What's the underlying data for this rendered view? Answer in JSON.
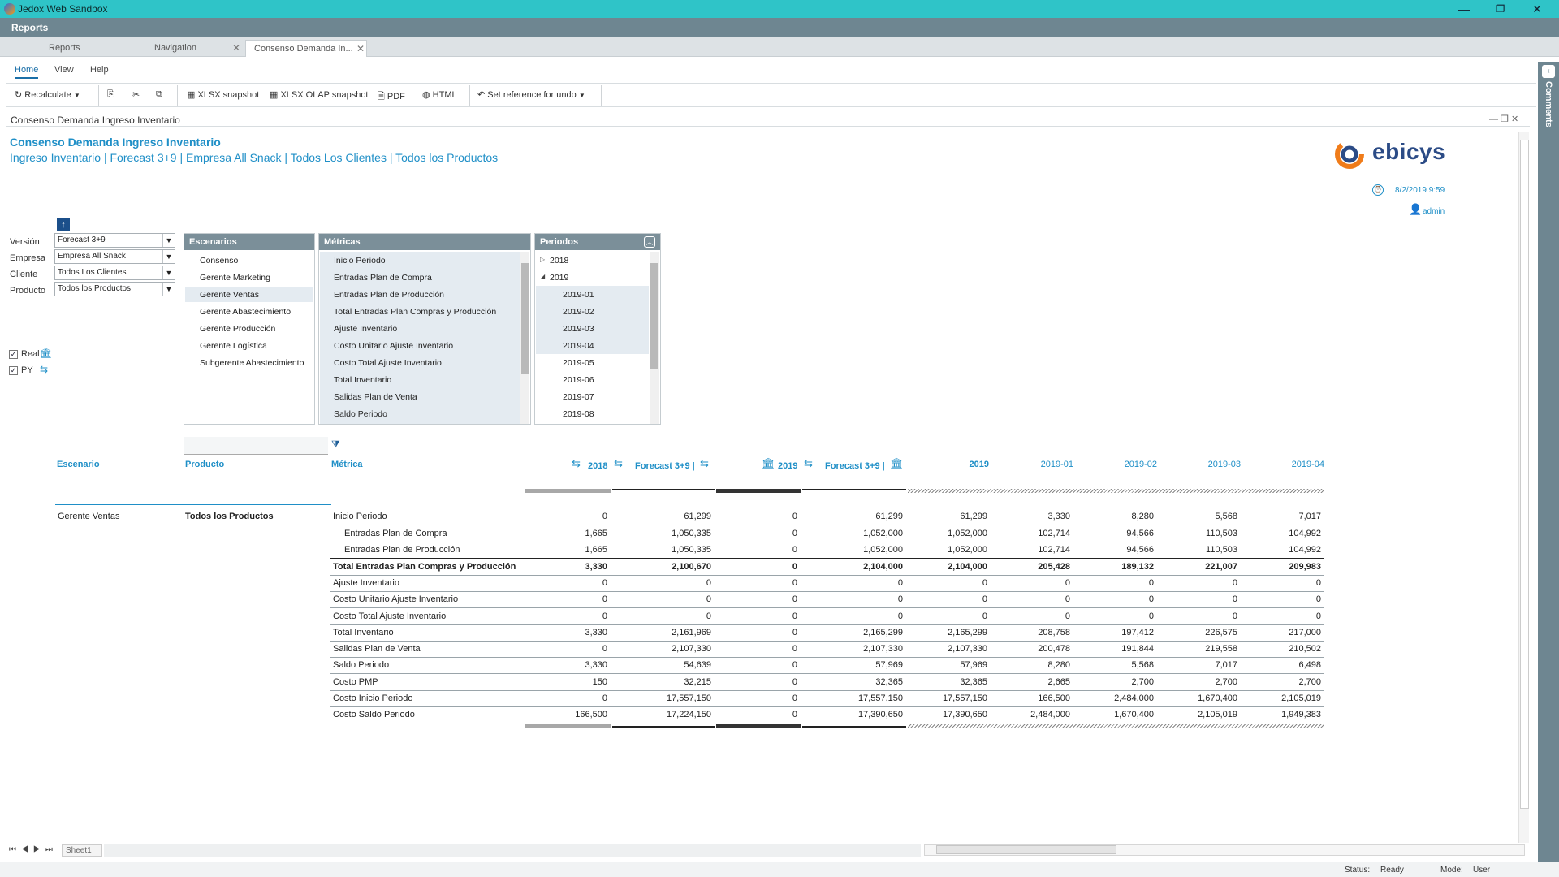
{
  "window": {
    "title": "Jedox Web Sandbox",
    "minimize": "—",
    "maximize": "❐",
    "close": "✕"
  },
  "app": {
    "reports_label": "Reports"
  },
  "tabs": [
    {
      "label": "Reports"
    },
    {
      "label": "Navigation",
      "close": "✕"
    },
    {
      "label": "Consenso Demanda In...",
      "close": "✕"
    }
  ],
  "ribbon": {
    "tabs": [
      "Home",
      "View",
      "Help"
    ],
    "toolbar": {
      "recalculate": "Recalculate",
      "xlsx": "XLSX snapshot",
      "xlsx_olap": "XLSX OLAP snapshot",
      "pdf": "PDF",
      "html": "HTML",
      "set_ref": "Set reference for undo"
    }
  },
  "sheet": {
    "title": "Consenso Demanda Ingreso Inventario",
    "heading": "Consenso Demanda Ingreso Inventario",
    "subheading": "Ingreso Inventario  | Forecast 3+9 | Empresa All Snack | Todos Los Clientes | Todos los Productos",
    "logo": "ebicys",
    "timestamp": "8/2/2019 9:59",
    "user": "admin"
  },
  "side": {
    "comments": "Comments"
  },
  "filters": [
    {
      "label": "Versión",
      "value": "Forecast 3+9"
    },
    {
      "label": "Empresa",
      "value": "Empresa All Snack"
    },
    {
      "label": "Cliente",
      "value": "Todos Los Clientes"
    },
    {
      "label": "Producto",
      "value": "Todos los Productos"
    }
  ],
  "checks": [
    {
      "label": "Real",
      "checked": true
    },
    {
      "label": "PY",
      "checked": true
    }
  ],
  "lists": {
    "escenarios": {
      "title": "Escenarios",
      "items": [
        "Consenso",
        "Gerente Marketing",
        "Gerente Ventas",
        "Gerente Abastecimiento",
        "Gerente Producción",
        "Gerente Logística",
        "Subgerente Abastecimiento"
      ],
      "selected": 2
    },
    "metricas": {
      "title": "Métricas",
      "items": [
        "Inicio Periodo",
        "Entradas Plan de Compra",
        "Entradas Plan de Producción",
        "Total Entradas Plan Compras y Producción",
        "Ajuste Inventario",
        "Costo Unitario Ajuste Inventario",
        "Costo Total Ajuste Inventario",
        "Total Inventario",
        "Salidas Plan de Venta",
        "Saldo Periodo"
      ]
    },
    "periodos": {
      "title": "Periodos",
      "items": [
        "2018",
        "2019",
        "2019-01",
        "2019-02",
        "2019-03",
        "2019-04",
        "2019-05",
        "2019-06",
        "2019-07",
        "2019-08"
      ]
    }
  },
  "grid": {
    "headers": {
      "escenario": "Escenario",
      "producto": "Producto",
      "metrica": "Métrica",
      "cols": [
        "2018",
        "Forecast 3+9 |",
        "2019",
        "Forecast 3+9 |",
        "2019",
        "2019-01",
        "2019-02",
        "2019-03",
        "2019-04"
      ]
    },
    "row_scenario": "Gerente Ventas",
    "row_product": "Todos los Productos",
    "rows": [
      {
        "m": "Inicio Periodo",
        "v": [
          "0",
          "61,299",
          "0",
          "61,299",
          "61,299",
          "3,330",
          "8,280",
          "5,568",
          "7,017"
        ]
      },
      {
        "m": "Entradas Plan de Compra",
        "v": [
          "1,665",
          "1,050,335",
          "0",
          "1,052,000",
          "1,052,000",
          "102,714",
          "94,566",
          "110,503",
          "104,992"
        ]
      },
      {
        "m": "Entradas Plan de Producción",
        "v": [
          "1,665",
          "1,050,335",
          "0",
          "1,052,000",
          "1,052,000",
          "102,714",
          "94,566",
          "110,503",
          "104,992"
        ]
      },
      {
        "m": "Total Entradas Plan Compras y Producción",
        "v": [
          "3,330",
          "2,100,670",
          "0",
          "2,104,000",
          "2,104,000",
          "205,428",
          "189,132",
          "221,007",
          "209,983"
        ]
      },
      {
        "m": "Ajuste Inventario",
        "v": [
          "0",
          "0",
          "0",
          "0",
          "0",
          "0",
          "0",
          "0",
          "0"
        ]
      },
      {
        "m": "Costo Unitario Ajuste Inventario",
        "v": [
          "0",
          "0",
          "0",
          "0",
          "0",
          "0",
          "0",
          "0",
          "0"
        ]
      },
      {
        "m": "Costo Total Ajuste Inventario",
        "v": [
          "0",
          "0",
          "0",
          "0",
          "0",
          "0",
          "0",
          "0",
          "0"
        ]
      },
      {
        "m": "Total Inventario",
        "v": [
          "3,330",
          "2,161,969",
          "0",
          "2,165,299",
          "2,165,299",
          "208,758",
          "197,412",
          "226,575",
          "217,000"
        ]
      },
      {
        "m": "Salidas Plan de Venta",
        "v": [
          "0",
          "2,107,330",
          "0",
          "2,107,330",
          "2,107,330",
          "200,478",
          "191,844",
          "219,558",
          "210,502"
        ]
      },
      {
        "m": "Saldo Periodo",
        "v": [
          "3,330",
          "54,639",
          "0",
          "57,969",
          "57,969",
          "8,280",
          "5,568",
          "7,017",
          "6,498"
        ]
      },
      {
        "m": "Costo PMP",
        "v": [
          "150",
          "32,215",
          "0",
          "32,365",
          "32,365",
          "2,665",
          "2,700",
          "2,700",
          "2,700"
        ]
      },
      {
        "m": "Costo Inicio Periodo",
        "v": [
          "0",
          "17,557,150",
          "0",
          "17,557,150",
          "17,557,150",
          "166,500",
          "2,484,000",
          "1,670,400",
          "2,105,019"
        ]
      },
      {
        "m": "Costo Saldo Periodo",
        "v": [
          "166,500",
          "17,224,150",
          "0",
          "17,390,650",
          "17,390,650",
          "2,484,000",
          "1,670,400",
          "2,105,019",
          "1,949,383"
        ]
      }
    ]
  },
  "bottom": {
    "sheet_tab": "Sheet1"
  },
  "status": {
    "status_label": "Status:",
    "status_value": "Ready",
    "mode_label": "Mode:",
    "mode_value": "User"
  }
}
